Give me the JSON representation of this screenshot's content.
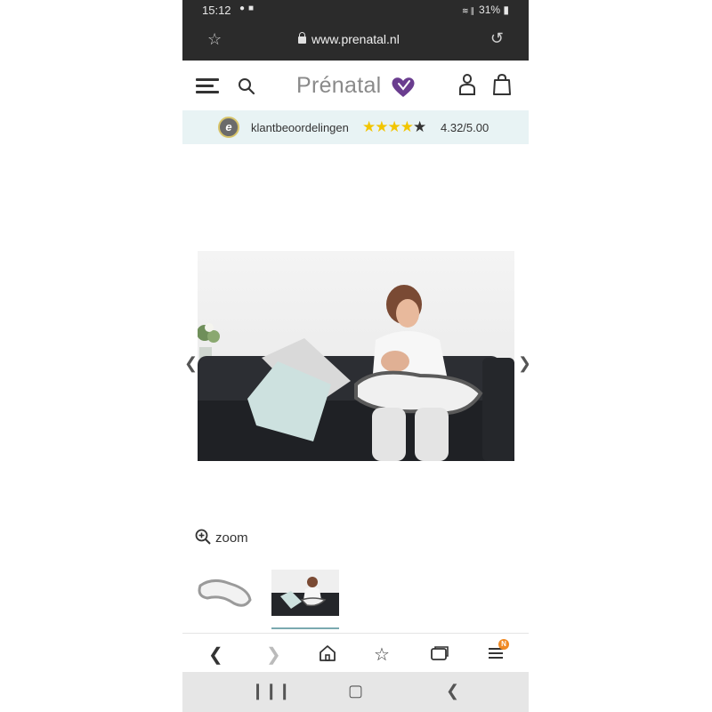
{
  "status_bar": {
    "time": "15:12",
    "battery": "31%"
  },
  "browser": {
    "url": "www.prenatal.nl"
  },
  "site": {
    "logo_text": "Prénatal"
  },
  "rating": {
    "label": "klantbeoordelingen",
    "score": "4.32/5.00",
    "stars_filled": 4,
    "stars_total": 5
  },
  "product": {
    "zoom_label": "zoom"
  },
  "toolbar": {
    "tabs_notification": "N"
  },
  "colors": {
    "status_bar_bg": "#2b2b2b",
    "rating_bar_bg": "#e8f3f4",
    "star_color": "#f2c500",
    "logo_heart": "#6a3d8f",
    "notification": "#f08a24"
  }
}
